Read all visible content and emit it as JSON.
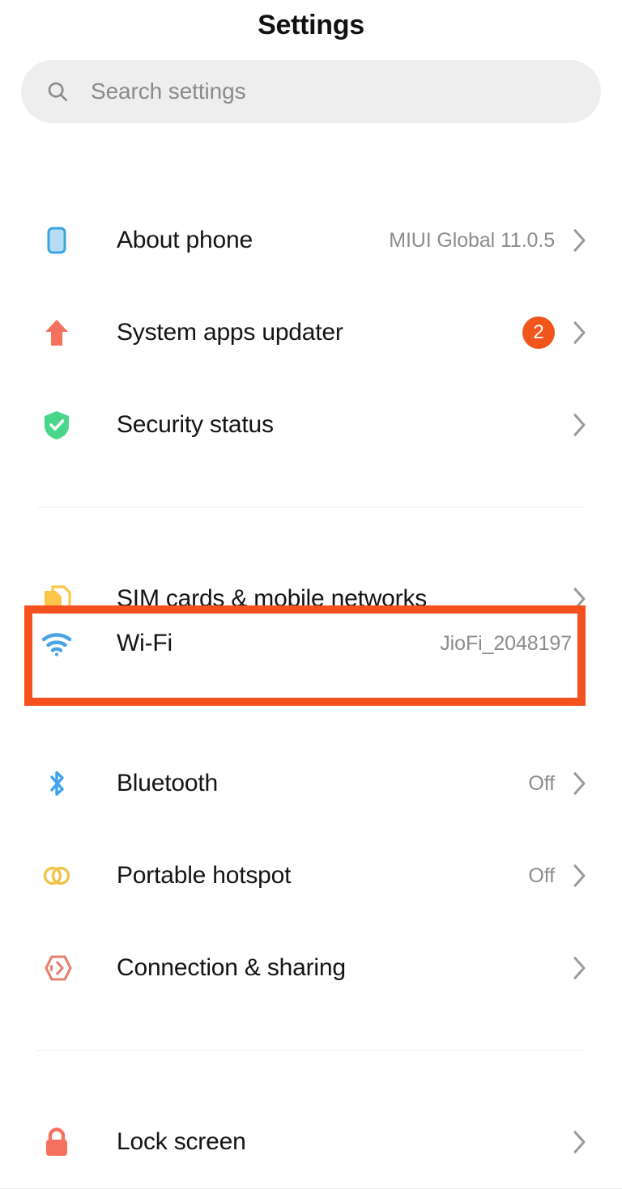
{
  "header": {
    "title": "Settings"
  },
  "search": {
    "placeholder": "Search settings",
    "value": "",
    "icon": "search-icon"
  },
  "highlight": {
    "target": "Wi-Fi",
    "color": "#f4511e"
  },
  "groups": [
    {
      "id": "device-group",
      "items": [
        {
          "key": "about-phone",
          "label": "About phone",
          "value": "MIUI Global 11.0.5",
          "badge": "",
          "icon": "phone-icon",
          "icon_color": "#a8d8f0",
          "chevron": true
        },
        {
          "key": "system-apps-updater",
          "label": "System apps updater",
          "value": "",
          "badge": "2",
          "badge_color": "#f1551b",
          "icon": "arrow-up-icon",
          "icon_color": "#f4715f",
          "chevron": true
        },
        {
          "key": "security-status",
          "label": "Security status",
          "value": "",
          "badge": "",
          "icon": "shield-check-icon",
          "icon_color": "#4ad68a",
          "chevron": true
        }
      ]
    },
    {
      "id": "connectivity-group",
      "items": [
        {
          "key": "sim-cards-mobile-networks",
          "label": "SIM cards & mobile networks",
          "value": "",
          "badge": "",
          "icon": "sim-cards-icon",
          "icon_color": "#fbc54a",
          "chevron": true
        },
        {
          "key": "wifi",
          "label": "Wi-Fi",
          "value": "JioFi_2048197",
          "badge": "",
          "icon": "wifi-icon",
          "icon_color": "#4aa3e8",
          "chevron": true,
          "highlighted": true
        },
        {
          "key": "bluetooth",
          "label": "Bluetooth",
          "value": "Off",
          "badge": "",
          "icon": "bluetooth-icon",
          "icon_color": "#3fa3f0",
          "chevron": true
        },
        {
          "key": "portable-hotspot",
          "label": "Portable hotspot",
          "value": "Off",
          "badge": "",
          "icon": "hotspot-icon",
          "icon_color": "#f0c44a",
          "chevron": true
        },
        {
          "key": "connection-sharing",
          "label": "Connection & sharing",
          "value": "",
          "badge": "",
          "icon": "connection-sharing-icon",
          "icon_color": "#e8806e",
          "chevron": true
        }
      ]
    },
    {
      "id": "personal-group",
      "items": [
        {
          "key": "lock-screen",
          "label": "Lock screen",
          "value": "",
          "badge": "",
          "icon": "lock-icon",
          "icon_color": "#f4715f",
          "chevron": true
        }
      ]
    }
  ]
}
